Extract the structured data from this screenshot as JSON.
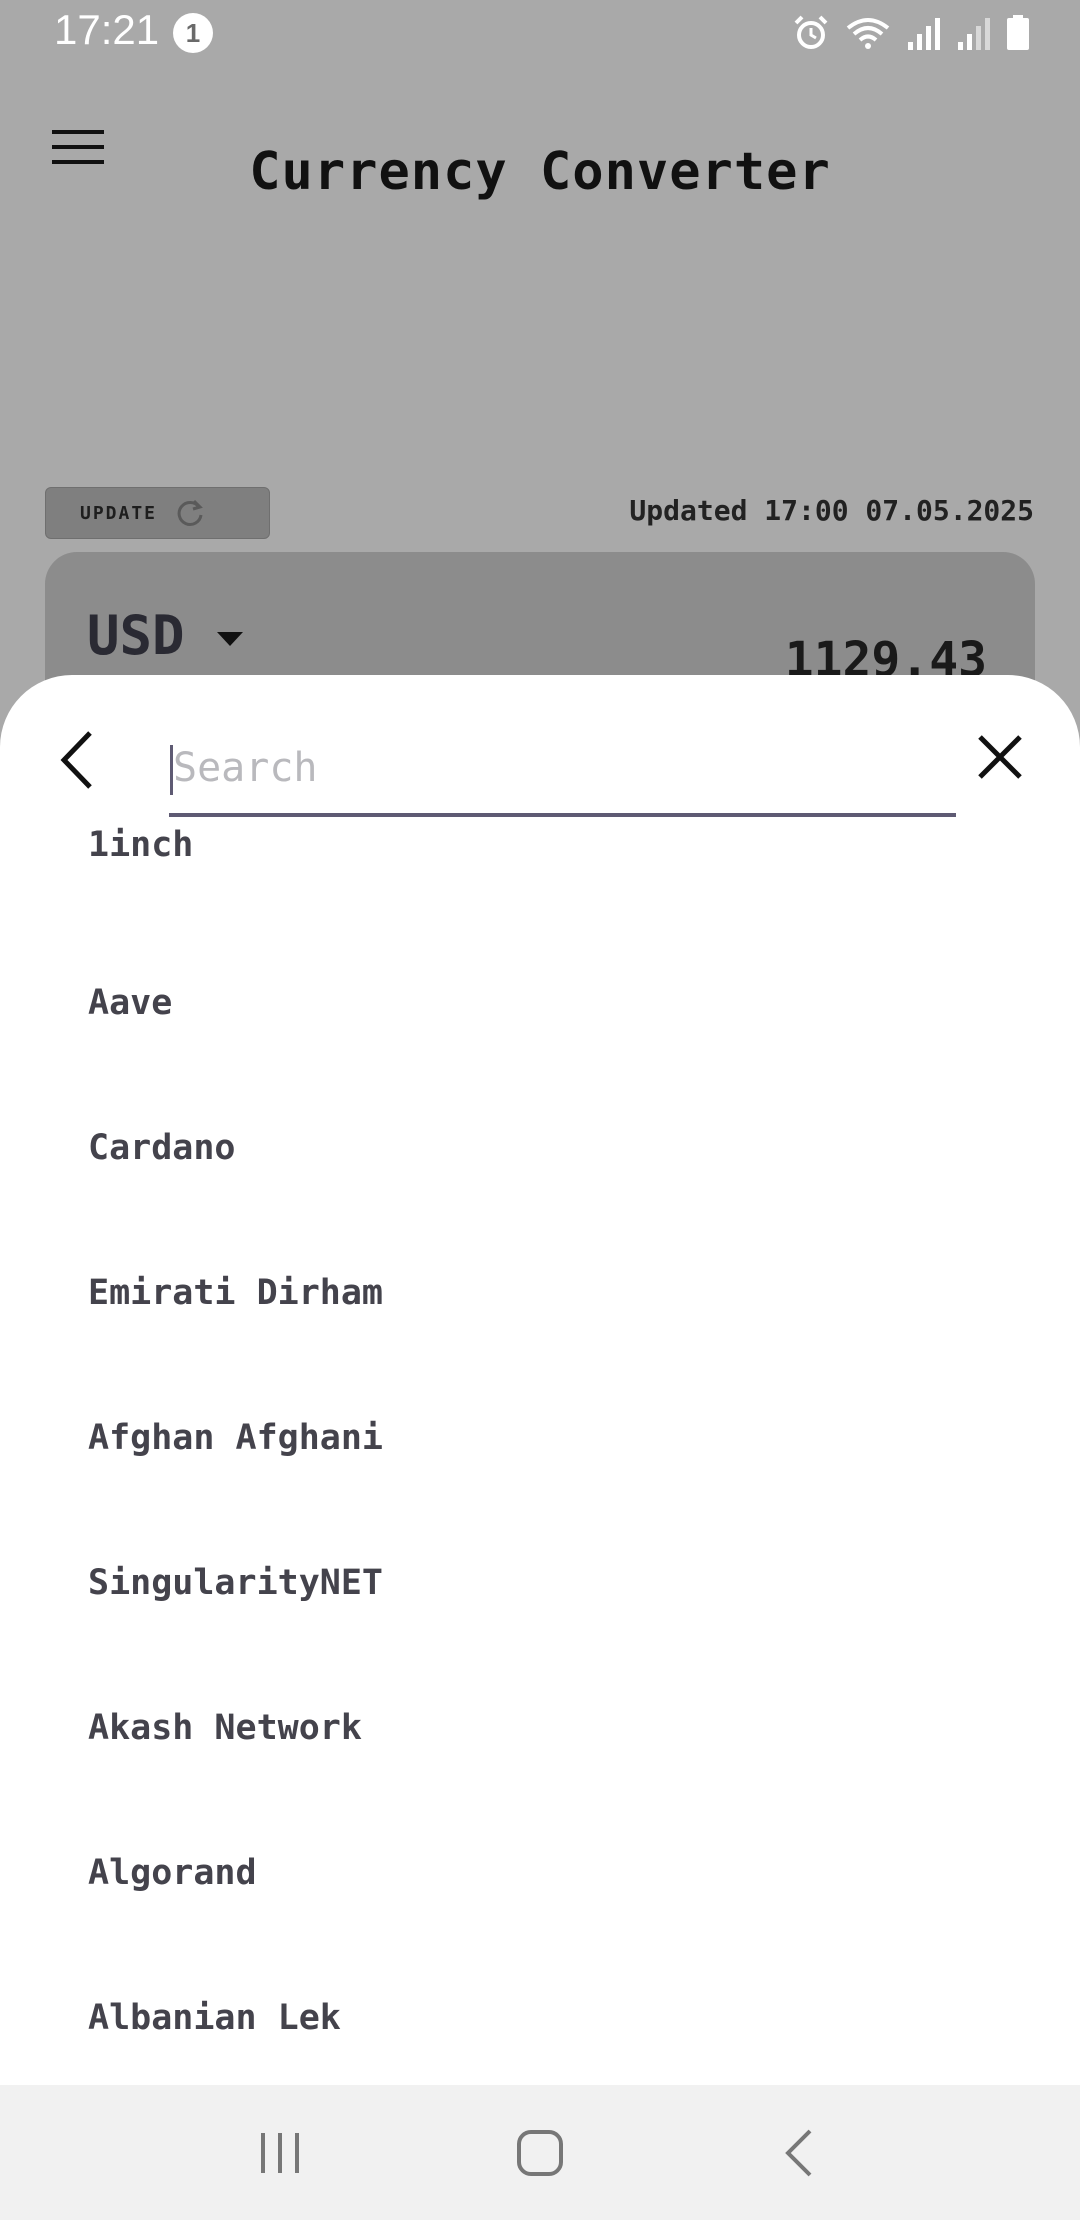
{
  "status_bar": {
    "time": "17:21",
    "notification_count": "1"
  },
  "app": {
    "title": "Currency Converter",
    "update_label": "UPDATE",
    "updated_text": "Updated 17:00 07.05.2025",
    "card": {
      "currency_code": "USD",
      "amount": "1129.43"
    }
  },
  "sheet": {
    "search_placeholder": "Search",
    "search_value": "",
    "items": [
      "1inch",
      "Aave",
      "Cardano",
      "Emirati Dirham",
      "Afghan Afghani",
      "SingularityNET",
      "Akash Network",
      "Algorand",
      "Albanian Lek"
    ]
  },
  "colors": {
    "scrim_background": "#a9a9a9",
    "sheet_background": "#ffffff",
    "accent_underline": "#5e5a73",
    "list_text": "#44434c"
  },
  "icons": {
    "menu": "hamburger-icon",
    "refresh": "refresh-icon",
    "dropdown": "caret-down-icon",
    "back": "chevron-left-icon",
    "close": "close-icon",
    "nav_recents": "recents-icon",
    "nav_home": "home-icon",
    "nav_back": "back-icon"
  }
}
